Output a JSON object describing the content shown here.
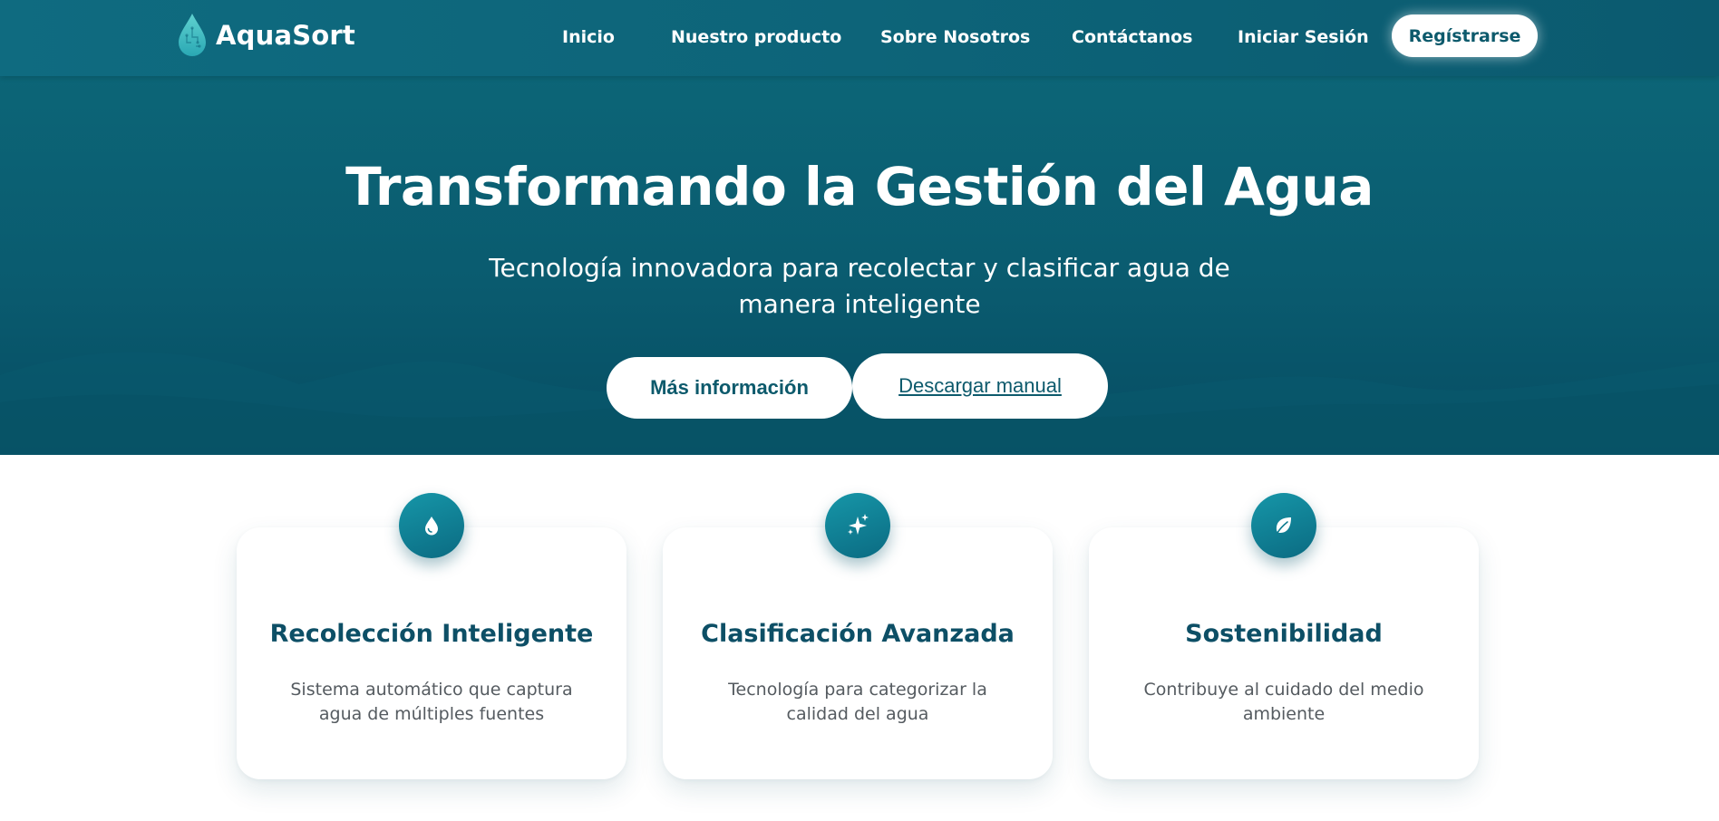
{
  "brand": {
    "name": "AquaSort",
    "logo_icon": "water-drop-circuit-icon"
  },
  "nav": {
    "links": [
      {
        "label": "Inicio"
      },
      {
        "label": "Nuestro producto"
      },
      {
        "label": "Sobre Nosotros"
      },
      {
        "label": "Contáctanos"
      },
      {
        "label": "Iniciar Sesión"
      }
    ],
    "register_label": "Regístrarse"
  },
  "hero": {
    "title": "Transformando la Gestión del Agua",
    "subtitle": "Tecnología innovadora para recolectar y clasificar agua de manera inteligente",
    "primary_button": "Más información",
    "secondary_button": " Descargar manual"
  },
  "features": [
    {
      "icon": "water-drop-icon",
      "title": "Recolección Inteligente",
      "description": "Sistema automático que captura agua de múltiples fuentes"
    },
    {
      "icon": "sparkles-icon",
      "title": "Clasificación Avanzada",
      "description": "Tecnología para categorizar la calidad del agua"
    },
    {
      "icon": "leaf-icon",
      "title": "Sostenibilidad",
      "description": "Contribuye al cuidado del medio ambiente"
    }
  ],
  "colors": {
    "primary": "#0b5f74",
    "accent": "#1696a8",
    "heading": "#0d4f66",
    "text_muted": "#555b60",
    "white": "#ffffff"
  }
}
